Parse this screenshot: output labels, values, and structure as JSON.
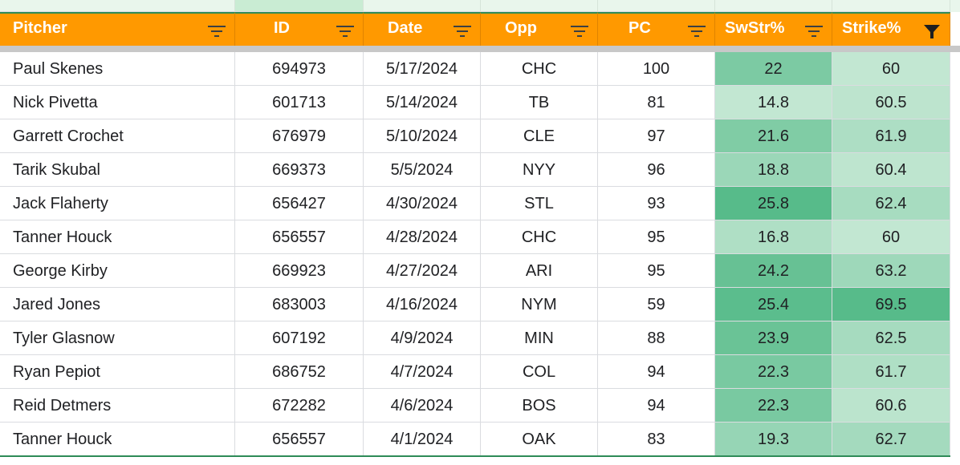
{
  "header": {
    "columns": [
      {
        "label": "Pitcher",
        "filter_active": false
      },
      {
        "label": "ID",
        "filter_active": false
      },
      {
        "label": "Date",
        "filter_active": false
      },
      {
        "label": "Opp",
        "filter_active": false
      },
      {
        "label": "PC",
        "filter_active": false
      },
      {
        "label": "SwStr%",
        "filter_active": false
      },
      {
        "label": "Strike%",
        "filter_active": true
      }
    ]
  },
  "rows": [
    {
      "pitcher": "Paul Skenes",
      "id": "694973",
      "date": "5/17/2024",
      "opp": "CHC",
      "pc": "100",
      "swstr": "22",
      "strike": "60"
    },
    {
      "pitcher": "Nick Pivetta",
      "id": "601713",
      "date": "5/14/2024",
      "opp": "TB",
      "pc": "81",
      "swstr": "14.8",
      "strike": "60.5"
    },
    {
      "pitcher": "Garrett Crochet",
      "id": "676979",
      "date": "5/10/2024",
      "opp": "CLE",
      "pc": "97",
      "swstr": "21.6",
      "strike": "61.9"
    },
    {
      "pitcher": "Tarik Skubal",
      "id": "669373",
      "date": "5/5/2024",
      "opp": "NYY",
      "pc": "96",
      "swstr": "18.8",
      "strike": "60.4"
    },
    {
      "pitcher": "Jack Flaherty",
      "id": "656427",
      "date": "4/30/2024",
      "opp": "STL",
      "pc": "93",
      "swstr": "25.8",
      "strike": "62.4"
    },
    {
      "pitcher": "Tanner Houck",
      "id": "656557",
      "date": "4/28/2024",
      "opp": "CHC",
      "pc": "95",
      "swstr": "16.8",
      "strike": "60"
    },
    {
      "pitcher": "George Kirby",
      "id": "669923",
      "date": "4/27/2024",
      "opp": "ARI",
      "pc": "95",
      "swstr": "24.2",
      "strike": "63.2"
    },
    {
      "pitcher": "Jared Jones",
      "id": "683003",
      "date": "4/16/2024",
      "opp": "NYM",
      "pc": "59",
      "swstr": "25.4",
      "strike": "69.5"
    },
    {
      "pitcher": "Tyler Glasnow",
      "id": "607192",
      "date": "4/9/2024",
      "opp": "MIN",
      "pc": "88",
      "swstr": "23.9",
      "strike": "62.5"
    },
    {
      "pitcher": "Ryan Pepiot",
      "id": "686752",
      "date": "4/7/2024",
      "opp": "COL",
      "pc": "94",
      "swstr": "22.3",
      "strike": "61.7"
    },
    {
      "pitcher": "Reid Detmers",
      "id": "672282",
      "date": "4/6/2024",
      "opp": "BOS",
      "pc": "94",
      "swstr": "22.3",
      "strike": "60.6"
    },
    {
      "pitcher": "Tanner Houck",
      "id": "656557",
      "date": "4/1/2024",
      "opp": "OAK",
      "pc": "83",
      "swstr": "19.3",
      "strike": "62.7"
    }
  ],
  "colors": {
    "header_bg": "#ff9900",
    "header_text": "#ffffff",
    "filter_icon": "#3c4043",
    "gradient_low": "#e6f5ea",
    "gradient_high": "#57bb8a"
  },
  "icons": {
    "filter": "filter-lines-icon",
    "filter_active": "funnel-icon"
  }
}
